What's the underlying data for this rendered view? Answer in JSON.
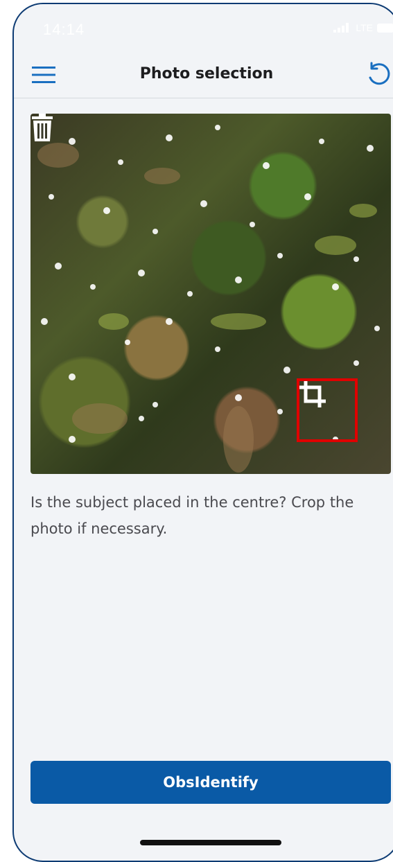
{
  "status_bar": {
    "time": "14:14",
    "network": "LTE"
  },
  "header": {
    "title": "Photo selection",
    "menu_icon": "hamburger-menu-icon",
    "reset_icon": "undo-rotate-icon"
  },
  "photo": {
    "delete_icon": "trash-icon",
    "crop_icon": "crop-icon",
    "highlight_color": "#e00000"
  },
  "hint": {
    "text": "Is the subject placed in the centre? Crop the photo if necessary."
  },
  "actions": {
    "identify_label": "ObsIdentify"
  },
  "colors": {
    "accent": "#0a5aa6",
    "background": "#f2f4f7"
  }
}
